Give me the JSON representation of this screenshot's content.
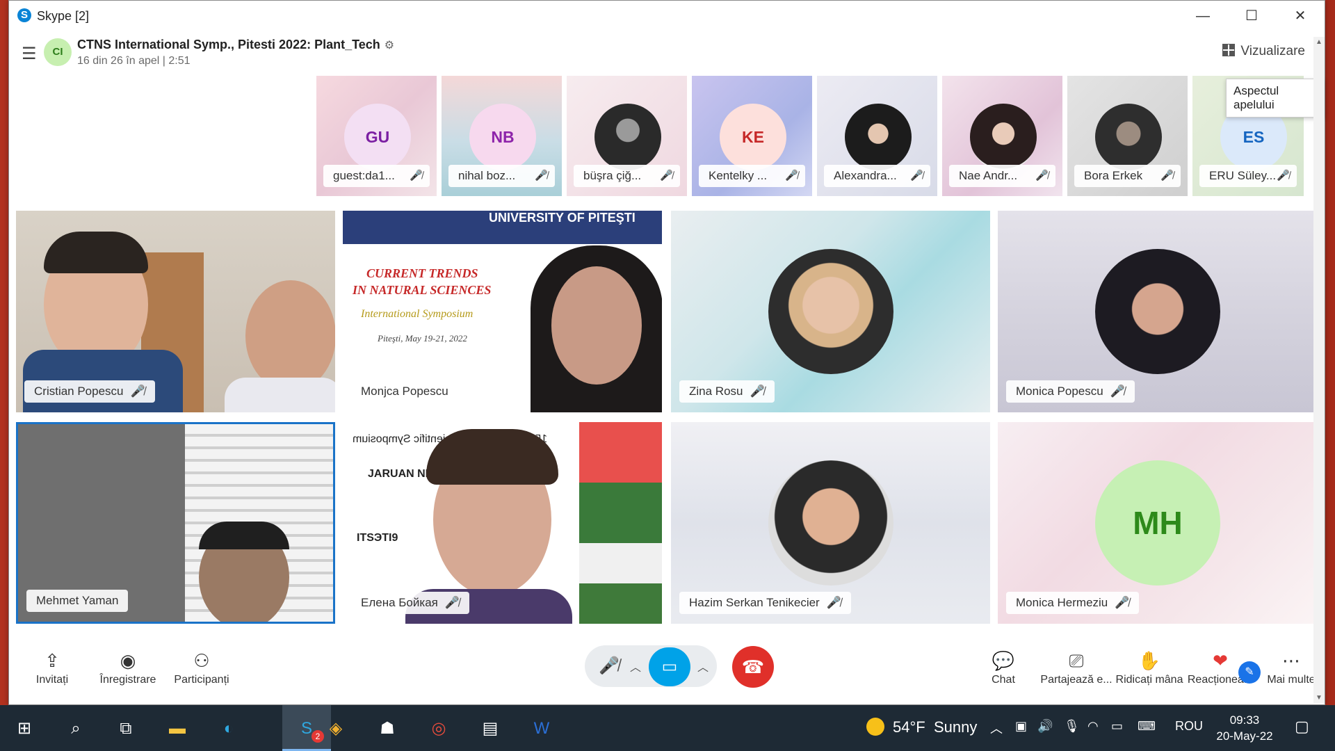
{
  "window": {
    "app_title": "Skype [2]",
    "app_icon_letter": "S",
    "controls": {
      "minimize": "—",
      "maximize": "☐",
      "close": "✕"
    }
  },
  "header": {
    "avatar_initials": "CI",
    "call_title": "CTNS International Symp., Pitesti 2022: Plant_Tech",
    "call_status": "16 din 26 în apel | 2:51",
    "view_label": "Vizualizare",
    "tooltip": "Aspectul apelului"
  },
  "thumbnails": [
    {
      "name": "guest:da1...",
      "initials": "GU",
      "color": "#6a1b9a",
      "circle_bg": "#f3dff3",
      "bg": "#f0d5dc"
    },
    {
      "name": "nihal boz...",
      "initials": "NB",
      "color": "#7b1fa2",
      "circle_bg": "#f8d9ee",
      "bg": "#e6d6d8"
    },
    {
      "name": "büşra çiğ...",
      "initials": "",
      "color": "#333",
      "circle_bg": "#3a3a3a",
      "bg": "#efe4e8"
    },
    {
      "name": "Kentelky ...",
      "initials": "KE",
      "color": "#c62828",
      "circle_bg": "#fde0dc",
      "bg": "#b9b8e4"
    },
    {
      "name": "Alexandra...",
      "initials": "",
      "color": "#333",
      "circle_bg": "#2b2b2b",
      "bg": "#e7e7ee"
    },
    {
      "name": "Nae Andr...",
      "initials": "",
      "color": "#333",
      "circle_bg": "#4a3a3a",
      "bg": "#eedce8"
    },
    {
      "name": "Bora Erkek",
      "initials": "",
      "color": "#333",
      "circle_bg": "#333333",
      "bg": "#dcdcdc"
    },
    {
      "name": "ERU Süley...",
      "initials": "ES",
      "color": "#1565c0",
      "circle_bg": "#dbe9fa",
      "bg": "#e3eed8"
    }
  ],
  "tiles": [
    {
      "name": "Cristian Popescu",
      "muted": true
    },
    {
      "name": "Monjca Popescu",
      "muted": false,
      "banner": "UNIVERSITY OF PITEŞTI",
      "poster_line1": "CURRENT TRENDS",
      "poster_line2": "IN NATURAL SCIENCES",
      "poster_line3": "International Symposium",
      "poster_line4": "Piteşti, May 19-21, 2022"
    },
    {
      "name": "Zina Rosu",
      "muted": true
    },
    {
      "name": "Monica Popescu",
      "muted": true
    },
    {
      "name": "Mehmet Yaman",
      "muted": false
    },
    {
      "name": "Елена Бойкая",
      "muted": true,
      "mirror_text1": "15th International Scientific Symposium",
      "mirror_text2": "JARUAN NI",
      "mirror_text3": "ITSЭTI9"
    },
    {
      "name": "Hazim Serkan Tenikecier",
      "muted": true
    },
    {
      "name": "Monica Hermeziu",
      "muted": true,
      "initials": "MH"
    }
  ],
  "bottom_bar": {
    "invite": "Invitați",
    "record": "Înregistrare",
    "participants": "Participanți",
    "chat": "Chat",
    "share": "Partajează e...",
    "raise_hand": "Ridicați mâna",
    "react": "Reacționea...",
    "more": "Mai multe"
  },
  "taskbar": {
    "skype_badge": "2",
    "temperature": "54°F",
    "weather": "Sunny",
    "language": "ROU",
    "time": "09:33",
    "date": "20-May-22"
  },
  "colors": {
    "accent": "#00a2e8",
    "end_call": "#e0302a",
    "selected_border": "#1a73c8",
    "taskbar": "#1e2a35"
  }
}
